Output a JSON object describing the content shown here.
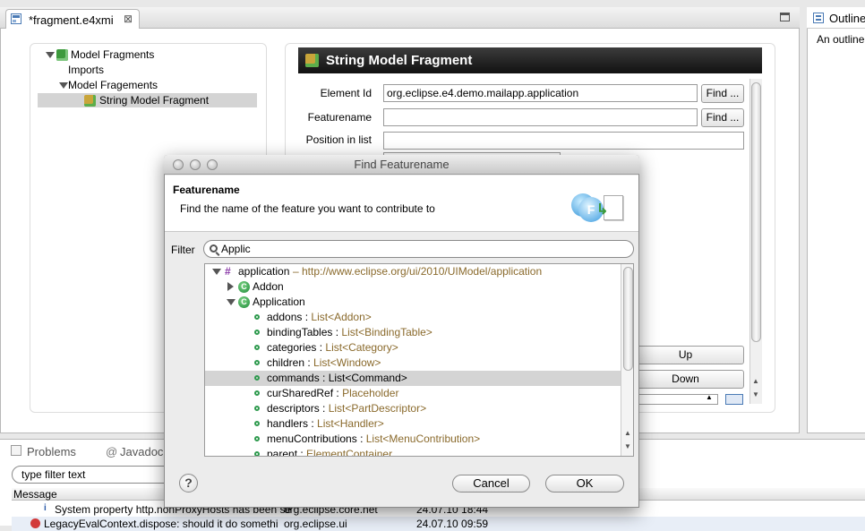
{
  "editor": {
    "tab_title": "*fragment.e4xmi",
    "tree": {
      "root": "Model Fragments",
      "imports": "Imports",
      "fragments": "Model Fragements",
      "selected": "String Model Fragment"
    },
    "detail": {
      "header": "String Model Fragment",
      "element_id_label": "Element Id",
      "element_id_value": "org.eclipse.e4.demo.mailapp.application",
      "featurename_label": "Featurename",
      "featurename_value": "",
      "position_label": "Position in list",
      "position_value": "",
      "find_label": "Find ...",
      "up_label": "Up",
      "down_label": "Down"
    }
  },
  "outline": {
    "tab_title": "Outline",
    "message": "An outline"
  },
  "bottom_panel": {
    "tab_problems": "Problems",
    "tab_javadoc": "Javadoc",
    "filter_placeholder": "type filter text",
    "col_message": "Message",
    "rows": [
      {
        "message": "System property http.nonProxyHosts has been se",
        "plugin": "org.eclipse.core.net",
        "date": "24.07.10 18:44",
        "icon": "info-icon"
      },
      {
        "message": "LegacyEvalContext.dispose: should it do somethi",
        "plugin": "org.eclipse.ui",
        "date": "24.07.10 09:59",
        "icon": "error-icon"
      }
    ]
  },
  "dialog": {
    "title": "Find Featurename",
    "heading": "Featurename",
    "description": "Find the name of the feature you want to contribute to",
    "filter_label": "Filter",
    "filter_value": "Applic",
    "tree": {
      "root_name": "application",
      "root_uri": " – http://www.eclipse.org/ui/2010/UIModel/application",
      "addon": "Addon",
      "application": "Application",
      "features": [
        {
          "name": "addons",
          "type": "List<Addon>"
        },
        {
          "name": "bindingTables",
          "type": "List<BindingTable>"
        },
        {
          "name": "categories",
          "type": "List<Category>"
        },
        {
          "name": "children",
          "type": "List<Window>"
        },
        {
          "name": "commands",
          "type": "List<Command>"
        },
        {
          "name": "curSharedRef",
          "type": "Placeholder"
        },
        {
          "name": "descriptors",
          "type": "List<PartDescriptor>"
        },
        {
          "name": "handlers",
          "type": "List<Handler>"
        },
        {
          "name": "menuContributions",
          "type": "List<MenuContribution>"
        },
        {
          "name": "parent",
          "type": "ElementContainer"
        }
      ]
    },
    "help_symbol": "?",
    "cancel_label": "Cancel",
    "ok_label": "OK"
  }
}
